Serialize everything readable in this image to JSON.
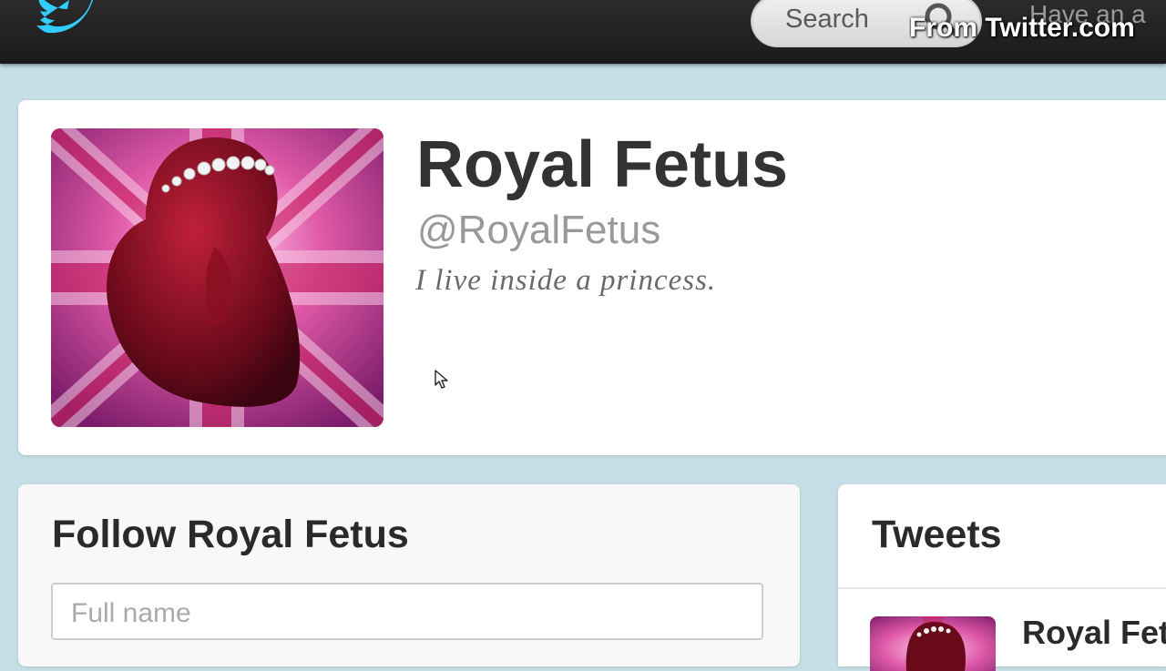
{
  "header": {
    "search_placeholder": "Search",
    "signin_text": "Have an a",
    "watermark": "From Twitter.com"
  },
  "profile": {
    "name": "Royal Fetus",
    "handle": "@RoyalFetus",
    "bio": "I live inside a princess."
  },
  "follow": {
    "title": "Follow Royal Fetus",
    "fullname_placeholder": "Full name"
  },
  "tweets": {
    "title": "Tweets",
    "first_author": "Royal Fetus"
  },
  "colors": {
    "topbar": "#1a1a1a",
    "page_background": "#c6dfe6",
    "card_background": "#ffffff",
    "logo_blue": "#33ccff"
  },
  "icons": {
    "logo": "twitter-bird-icon",
    "search": "search-icon",
    "cursor": "mouse-pointer-icon"
  }
}
